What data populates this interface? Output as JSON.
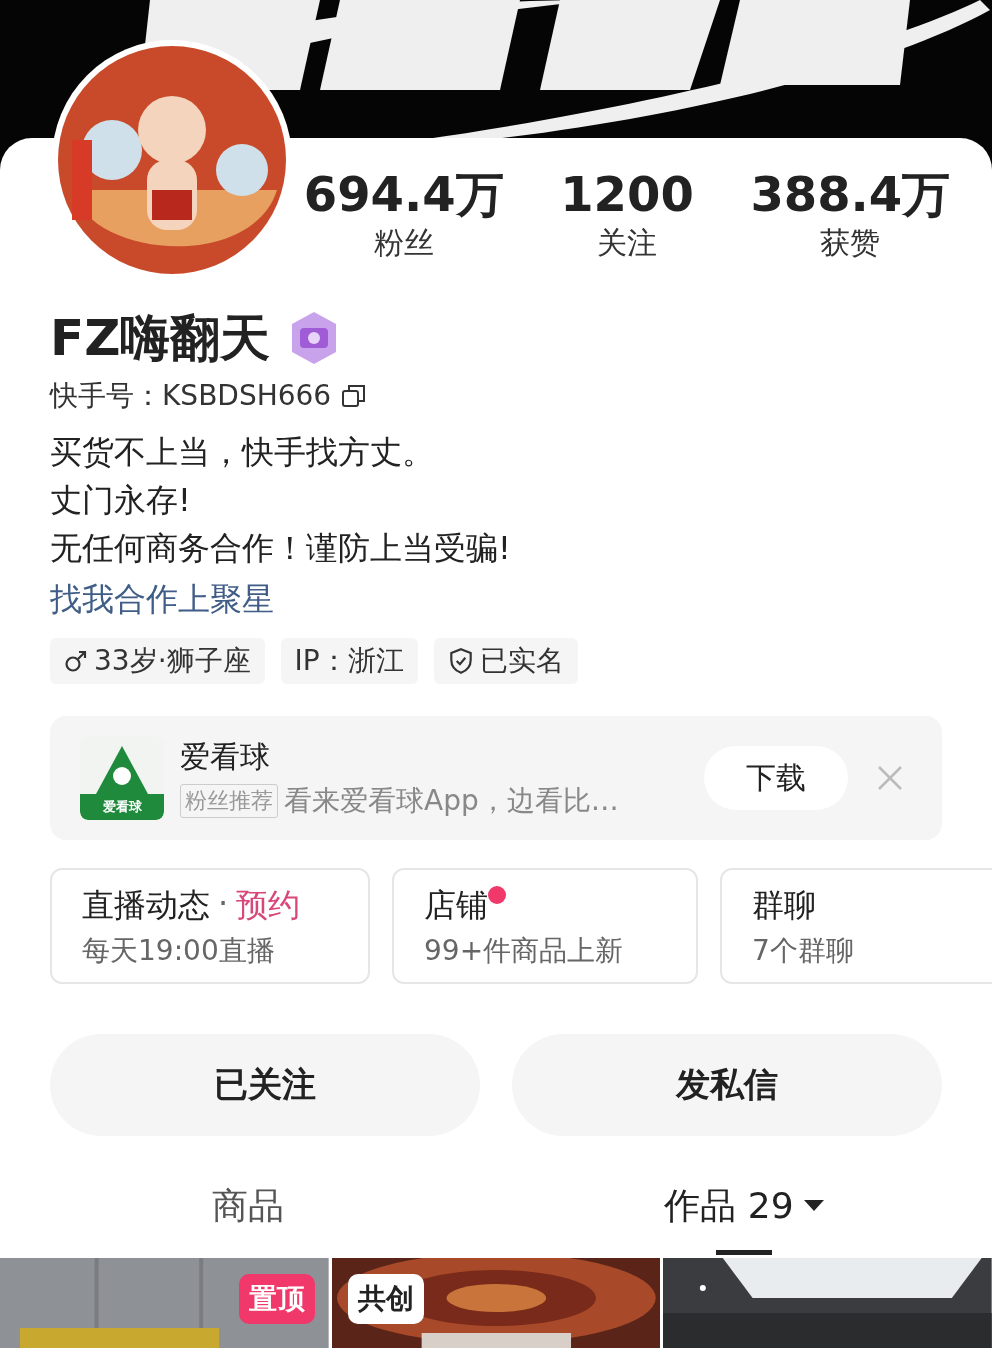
{
  "stats": [
    {
      "value": "694.4万",
      "label": "粉丝"
    },
    {
      "value": "1200",
      "label": "关注"
    },
    {
      "value": "388.4万",
      "label": "获赞"
    }
  ],
  "profile": {
    "name": "FZ嗨翻天",
    "account": "快手号：KSBDSH666",
    "bio": [
      "买货不上当，快手找方丈。",
      "丈门永存!",
      "无任何商务合作！谨防上当受骗!"
    ],
    "link": "找我合作上聚星"
  },
  "tags": [
    {
      "kind": "gender",
      "text": "33岁·狮子座"
    },
    {
      "kind": "plain",
      "text": "IP：浙江"
    },
    {
      "kind": "verified",
      "text": "已实名"
    }
  ],
  "ad": {
    "app_name": "爱看球",
    "logo_text": "爱看球",
    "tag": "粉丝推荐",
    "description": "看来爱看球App，边看比…",
    "button": "下载"
  },
  "shortcuts": [
    {
      "title": "直播动态",
      "separator": "·",
      "highlight": "预约",
      "subtitle": "每天19:00直播",
      "badge": false
    },
    {
      "title": "店铺",
      "subtitle": "99+件商品上新",
      "badge": true
    },
    {
      "title": "群聊",
      "subtitle": "7个群聊",
      "badge": false
    }
  ],
  "actions": [
    "已关注",
    "发私信"
  ],
  "tabs": [
    {
      "label": "商品",
      "selected": false,
      "dropdown": false
    },
    {
      "label": "作品 29",
      "selected": true,
      "dropdown": true
    }
  ],
  "videos": [
    {
      "kind": "picture",
      "badge": {
        "text": "置顶",
        "kind": "pinned"
      }
    },
    {
      "kind": "picture",
      "badge": {
        "text": "共创",
        "kind": "collab"
      }
    },
    {
      "kind": "picture"
    }
  ]
}
